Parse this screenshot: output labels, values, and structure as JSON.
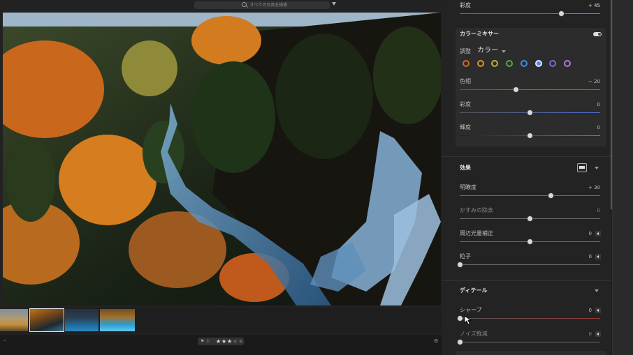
{
  "search": {
    "placeholder": "すべての写真を検索"
  },
  "filmstrip": {
    "thumbnails": [
      "thumb-1",
      "thumb-2",
      "thumb-3",
      "thumb-4"
    ],
    "selected_index": 1
  },
  "bottom_bar": {
    "flag_icons": [
      "flag-icon",
      "unflag-icon"
    ],
    "rating": {
      "value": 3,
      "max": 5,
      "star": "★"
    },
    "icons": {
      "left": "chevron-down-icon",
      "right": "settings-icon"
    }
  },
  "panel": {
    "top_slider": {
      "label": "彩度",
      "value": "+ 45",
      "fill": 0.725
    },
    "color_mixer": {
      "title": "カラーミキサー",
      "adjust_label": "調整",
      "adjust_value": "カラー",
      "swatches": [
        {
          "name": "red",
          "color": "#d8642a"
        },
        {
          "name": "orange",
          "color": "#e0962a"
        },
        {
          "name": "yellow",
          "color": "#c9b030"
        },
        {
          "name": "green",
          "color": "#54a84a"
        },
        {
          "name": "aqua",
          "color": "#3a8ee0"
        },
        {
          "name": "blue",
          "color": "#4d87ef",
          "selected": true
        },
        {
          "name": "purple",
          "color": "#7a6ae0"
        },
        {
          "name": "magenta",
          "color": "#b07ae0"
        }
      ],
      "sliders": [
        {
          "label": "色相",
          "value": "− 20",
          "fill": 0.4
        },
        {
          "label": "彩度",
          "value": "0",
          "fill": 0.5
        },
        {
          "label": "輝度",
          "value": "0",
          "fill": 0.5
        }
      ]
    },
    "effects": {
      "title": "効果",
      "sliders": [
        {
          "label": "明瞭度",
          "value": "+ 30",
          "fill": 0.65
        },
        {
          "label": "かすみの除去",
          "value": "0",
          "fill": 0.5
        },
        {
          "label": "周辺光量補正",
          "value": "0",
          "fill": 0.5
        },
        {
          "label": "粒子",
          "value": "0",
          "fill": 0.0
        }
      ]
    },
    "detail": {
      "title": "ディテール",
      "sliders": [
        {
          "label": "シャープ",
          "value": "0",
          "fill": 0.0
        },
        {
          "label": "ノイズ軽減",
          "value": "0",
          "fill": 0.0
        }
      ]
    }
  },
  "accent": "#4d87ef"
}
